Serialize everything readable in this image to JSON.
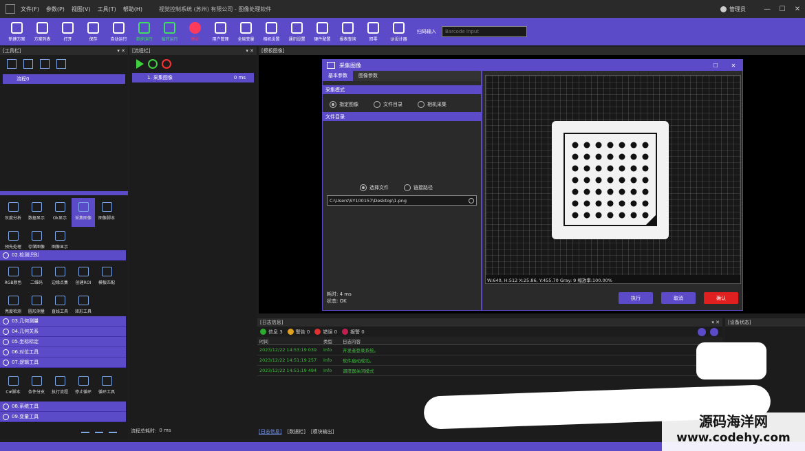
{
  "titlebar": {
    "menus": [
      "文件(F)",
      "参数(P)",
      "视图(V)",
      "工具(T)",
      "帮助(H)"
    ],
    "title": "视觉控制系统 (苏州) 有限公司 - 图像处理软件",
    "user": "管理员",
    "win_controls": [
      "—",
      "☐",
      "✕"
    ]
  },
  "toolbar": {
    "buttons": [
      {
        "label": "新建方案",
        "color": "#ffffff"
      },
      {
        "label": "方案列表",
        "color": "#ffffff"
      },
      {
        "label": "打开",
        "color": "#ffffff"
      },
      {
        "label": "保存",
        "color": "#ffffff"
      },
      {
        "label": "自动运行",
        "color": "#ffffff"
      },
      {
        "label": "单步运行",
        "color": "#3fe060"
      },
      {
        "label": "循环运行",
        "color": "#3fe060"
      },
      {
        "label": "停止",
        "color": "#ff3b5c"
      },
      {
        "label": "用户管理",
        "color": "#ffffff"
      },
      {
        "label": "全局变量",
        "color": "#ffffff"
      },
      {
        "label": "相机设置",
        "color": "#ffffff"
      },
      {
        "label": "通讯设置",
        "color": "#ffffff"
      },
      {
        "label": "硬件配置",
        "color": "#ffffff"
      },
      {
        "label": "报表查询",
        "color": "#ffffff"
      },
      {
        "label": "回零",
        "color": "#ffffff"
      },
      {
        "label": "UI设计器",
        "color": "#ffffff"
      }
    ],
    "scan_label": "扫码输入",
    "scan_placeholder": "Barcode Input"
  },
  "toolpanel": {
    "header": "[工具栏]",
    "pins": "▾ ✕",
    "tree_item": "流程0",
    "group1": [
      "灰度分析",
      "数据显示",
      "Ok显示",
      "采集图像",
      "图像脚本",
      "预先处理",
      "存储图像",
      "图像显示"
    ],
    "section_detect": "02.检测识别",
    "group2": [
      "RGB颜色",
      "二维码",
      "边缘点集",
      "创建ROI",
      "模板匹配",
      "亮度检测",
      "圆形测量",
      "直线工具",
      "矩形工具"
    ],
    "sections_mid": [
      "03.几何测量",
      "04.几何关系",
      "05.坐标标定",
      "06.对位工具",
      "07.逻辑工具"
    ],
    "group3": [
      "C#脚本",
      "条件分支",
      "执行流程",
      "停止循环",
      "循环工具"
    ],
    "sections_bottom": [
      "08.系统工具",
      "09.变量工具"
    ]
  },
  "flowpanel": {
    "header": "[流程栏]",
    "pins": "▾ ✕",
    "item_label": "1. 采集图像",
    "item_time": "0 ms",
    "total_label": "流程总耗时:",
    "total_value": "0 ms"
  },
  "viewpanel": {
    "header": "[模板图像]"
  },
  "dialog": {
    "title": "采集图像",
    "tabs": [
      "基本参数",
      "图像参数"
    ],
    "section_mode": "采集模式",
    "modes": [
      "指定图像",
      "文件目录",
      "相机采集"
    ],
    "section_dir": "文件目录",
    "file_opts": [
      "选择文件",
      "链接路径"
    ],
    "path": "C:\\Users\\SY100157\\Desktop\\1.png",
    "elapsed": "耗时: 4 ms",
    "status": "状态: OK",
    "image_status": "W:640, H:512     X:25.86, Y:455.70     Gray: 9     缩放率:100.00%",
    "btn_run": "执行",
    "btn_cancel": "取消",
    "btn_ok": "确认",
    "colors": {
      "run": "#5b4bc9",
      "cancel": "#5b4bc9",
      "ok": "#e02020"
    }
  },
  "log": {
    "header": "[日志信息]",
    "pins": "▾ ✕",
    "filters": [
      {
        "label": "信息 3",
        "color": "#2eaa2e"
      },
      {
        "label": "警告 0",
        "color": "#e0a020"
      },
      {
        "label": "错误 0",
        "color": "#e03030"
      },
      {
        "label": "报警 0",
        "color": "#c02050"
      }
    ],
    "columns": [
      "时间",
      "类型",
      "日志内容"
    ],
    "rows": [
      {
        "time": "2023/12/22 14:53:19 039",
        "type": "Info",
        "msg": "开发者登录系统。"
      },
      {
        "time": "2023/12/22 14:51:19 257",
        "type": "Info",
        "msg": "软件启动成功。"
      },
      {
        "time": "2023/12/22 14:51:19 494",
        "type": "Info",
        "msg": "调度器关闭模式"
      }
    ],
    "bottom_tabs": [
      "[日志信息]",
      "[数据栏]",
      "[模块输出]"
    ]
  },
  "device": {
    "header": "[设备状态]"
  },
  "watermark": {
    "line1": "源码海洋网",
    "line2": "www.codehy.com"
  }
}
